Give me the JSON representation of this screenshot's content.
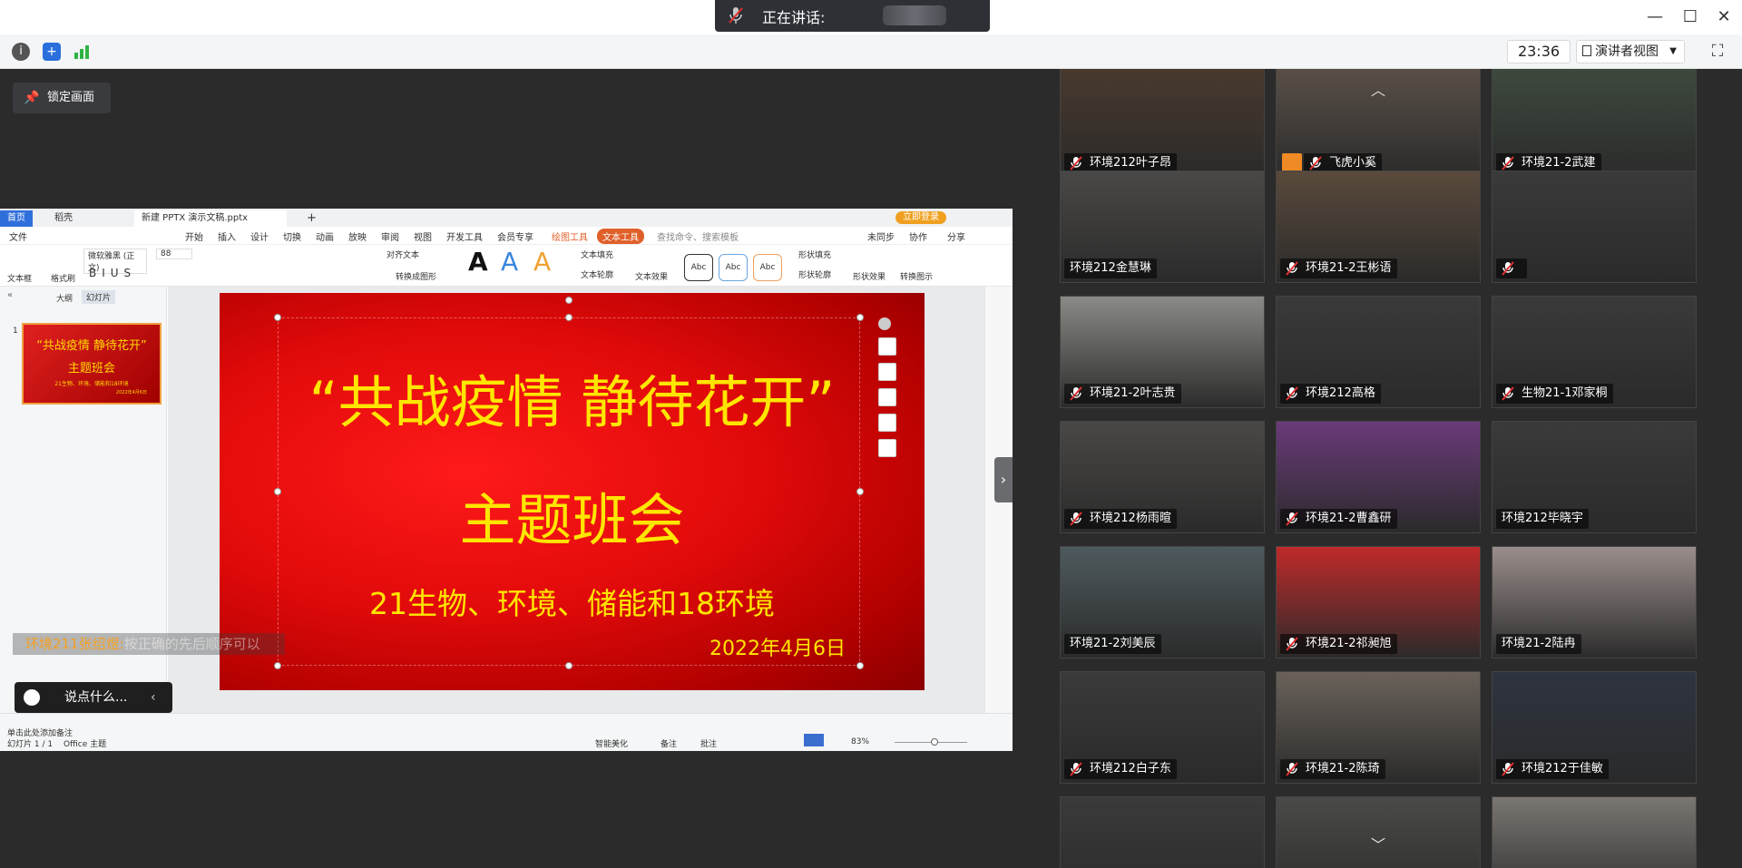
{
  "topbar": {
    "speaking_label": "正在讲话:",
    "clock": "23:36",
    "view_label": "演讲者视图"
  },
  "stage": {
    "lock_label": "锁定画面"
  },
  "wps": {
    "tabs": [
      "首页",
      "稻壳",
      "新建 PPTX 演示文稿.pptx"
    ],
    "login_label": "立即登录",
    "menu": [
      "文件",
      "开始",
      "插入",
      "设计",
      "切换",
      "动画",
      "放映",
      "审阅",
      "视图",
      "开发工具",
      "会员专享",
      "绘图工具",
      "文本工具",
      "查找命令、搜索模板",
      "未同步",
      "协作",
      "分享"
    ],
    "ribbon": {
      "font_name": "微软雅黑 (正文)",
      "font_size": "88",
      "items": [
        "文本框",
        "格式刷",
        "文本填充",
        "文本轮廓",
        "文本效果",
        "对齐文本",
        "转换成图形",
        "形状填充",
        "形状轮廓",
        "形状效果",
        "转换图示"
      ],
      "abc": [
        "Abc",
        "Abc",
        "Abc"
      ],
      "big_a": "A"
    },
    "left_tabs": [
      "大纲",
      "幻灯片"
    ],
    "thumb": {
      "num": "1",
      "l1": "“共战疫情 静待花开”",
      "l2": "主题班会",
      "l3": "21生物、环境、储能和18环境",
      "l4": "2022年4月6日"
    },
    "slide": {
      "title": "“共战疫情 静待花开”",
      "subtitle": "主题班会",
      "classes": "21生物、环境、储能和18环境",
      "date": "2022年4月6日"
    },
    "notes_placeholder": "单击此处添加备注",
    "status": {
      "page": "幻灯片 1 / 1",
      "theme": "Office 主题",
      "beautify": "智能美化",
      "notes": "备注",
      "comments": "批注",
      "zoom": "83%"
    }
  },
  "caption": {
    "speaker": "环境211张绍煜:",
    "text": "按正确的先后顺序可以"
  },
  "chat": {
    "placeholder": "说点什么..."
  },
  "gallery": [
    {
      "name": "环境212叶子昂",
      "bg": "#4a3a2e",
      "mic": true,
      "avatar": false
    },
    {
      "name": "飞虎小奚",
      "bg": "#5a5048",
      "mic": true,
      "avatar": true
    },
    {
      "name": "环境21-2武建",
      "bg": "#3e4a3e",
      "mic": true,
      "avatar": false
    },
    {
      "name": "环境212金慧琳",
      "bg": "#4a4846",
      "mic": false,
      "avatar": false
    },
    {
      "name": "环境21-2王彬语",
      "bg": "#5a4a3c",
      "mic": true,
      "avatar": false
    },
    {
      "name": "",
      "bg": "#3a3a3a",
      "mic": true,
      "avatar": false
    },
    {
      "name": "环境21-2叶志贵",
      "bg": "#8a8a86",
      "mic": true,
      "avatar": false
    },
    {
      "name": "环境212高格",
      "bg": "#3a3a3a",
      "mic": true,
      "avatar": false
    },
    {
      "name": "生物21-1邓家桐",
      "bg": "#3a3a3a",
      "mic": true,
      "avatar": false
    },
    {
      "name": "环境212杨雨暄",
      "bg": "#4a4846",
      "mic": true,
      "avatar": false
    },
    {
      "name": "环境21-2曹鑫研",
      "bg": "#6a3a7a",
      "mic": true,
      "avatar": false
    },
    {
      "name": "环境212毕晓宇",
      "bg": "#3a3a3a",
      "mic": false,
      "avatar": false
    },
    {
      "name": "环境21-2刘美辰",
      "bg": "#4e5a5e",
      "mic": false,
      "avatar": false
    },
    {
      "name": "环境21-2祁昶旭",
      "bg": "#c02a2a",
      "mic": true,
      "avatar": false
    },
    {
      "name": "环境21-2陆冉",
      "bg": "#9a8e8c",
      "mic": false,
      "avatar": false
    },
    {
      "name": "环境212白子东",
      "bg": "#3a3a3a",
      "mic": true,
      "avatar": false
    },
    {
      "name": "环境21-2陈琦",
      "bg": "#6a625a",
      "mic": true,
      "avatar": false
    },
    {
      "name": "环境212于佳敏",
      "bg": "#2e3440",
      "mic": true,
      "avatar": false
    },
    {
      "name": "",
      "bg": "#3a3a3a",
      "mic": false,
      "avatar": false
    },
    {
      "name": "",
      "bg": "#4a4a48",
      "mic": false,
      "avatar": false
    },
    {
      "name": "",
      "bg": "#7a7672",
      "mic": false,
      "avatar": false
    }
  ]
}
